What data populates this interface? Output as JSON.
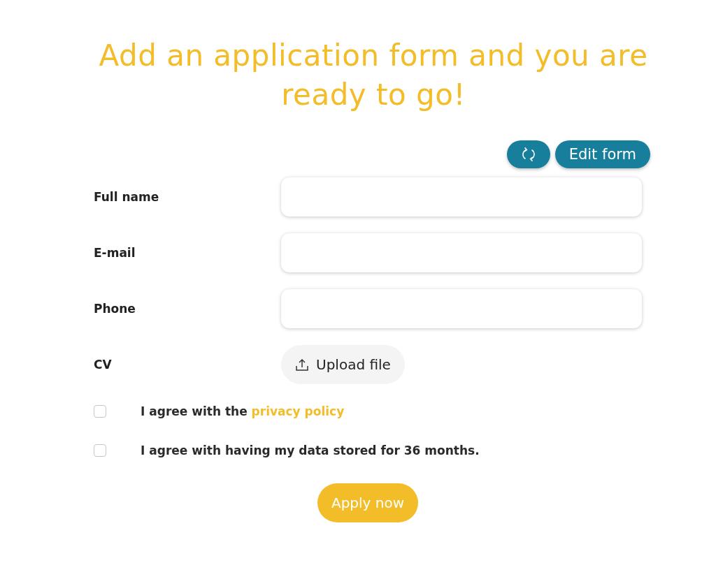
{
  "title": "Add an application form and you are ready to go!",
  "toolbar": {
    "refresh_button": {
      "kind": "refresh"
    },
    "edit_button": "Edit form"
  },
  "fields": [
    {
      "label": "Full name",
      "kind": "text"
    },
    {
      "label": "E-mail",
      "kind": "text"
    },
    {
      "label": "Phone",
      "kind": "text"
    },
    {
      "label": "CV",
      "kind": "upload",
      "button": "Upload file"
    }
  ],
  "agreements": [
    {
      "text": "I agree with the ",
      "link": "privacy policy",
      "checked": false
    },
    {
      "text": "I agree with having my data stored for 36 months.",
      "checked": false
    }
  ],
  "submit": "Apply now"
}
